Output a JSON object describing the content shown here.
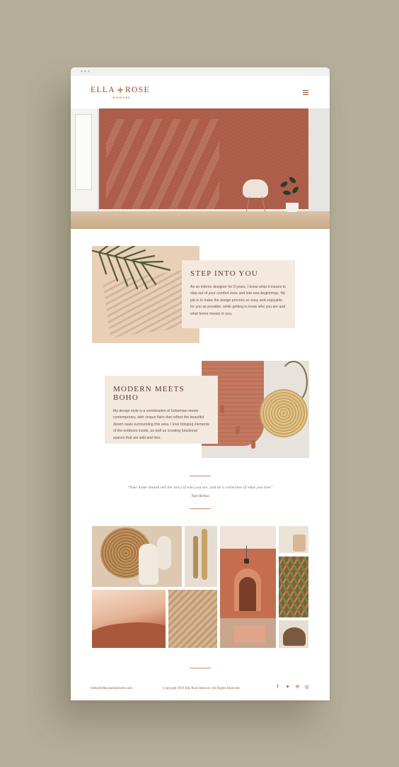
{
  "brand": {
    "name_part1": "ELLA",
    "name_part2": "ROSE",
    "tagline": "INTERIORS"
  },
  "header": {
    "menu_icon": "hamburger-icon"
  },
  "section_step": {
    "heading": "STEP INTO YOU",
    "body": "As an interior designer for 9 years, I know what it means to step out of your comfort zone and into new beginnings. My job is to make the design process as easy and enjoyable for you as possible, while getting to know who you are and what home means to you."
  },
  "section_boho": {
    "heading": "MODERN MEETS BOHO",
    "body": "My design style is a combination of bohemian meets contemporary, with unique flairs that reflect the beautiful desert oasis surrounding this area. I love bringing elements of the outdoors inside, as well as creating functional spaces that are wild and free."
  },
  "quote": {
    "text": "“Your home should tell the story of who you are, and be a collection of what you love”",
    "author": "Nate Berkus"
  },
  "footer": {
    "email": "hello@ellaroseinteriors.com",
    "copyright": "Copyright 2019 Ella Rose Interiors. All Rights Reserved.",
    "social": [
      {
        "icon": "facebook-icon",
        "glyph": "f"
      },
      {
        "icon": "twitter-icon",
        "glyph": "✦"
      },
      {
        "icon": "pinterest-icon",
        "glyph": "℗"
      },
      {
        "icon": "instagram-icon",
        "glyph": "◎"
      }
    ]
  },
  "colors": {
    "accent": "#8d4a2f",
    "background": "#b4ae98",
    "card": "#f3e9df"
  }
}
